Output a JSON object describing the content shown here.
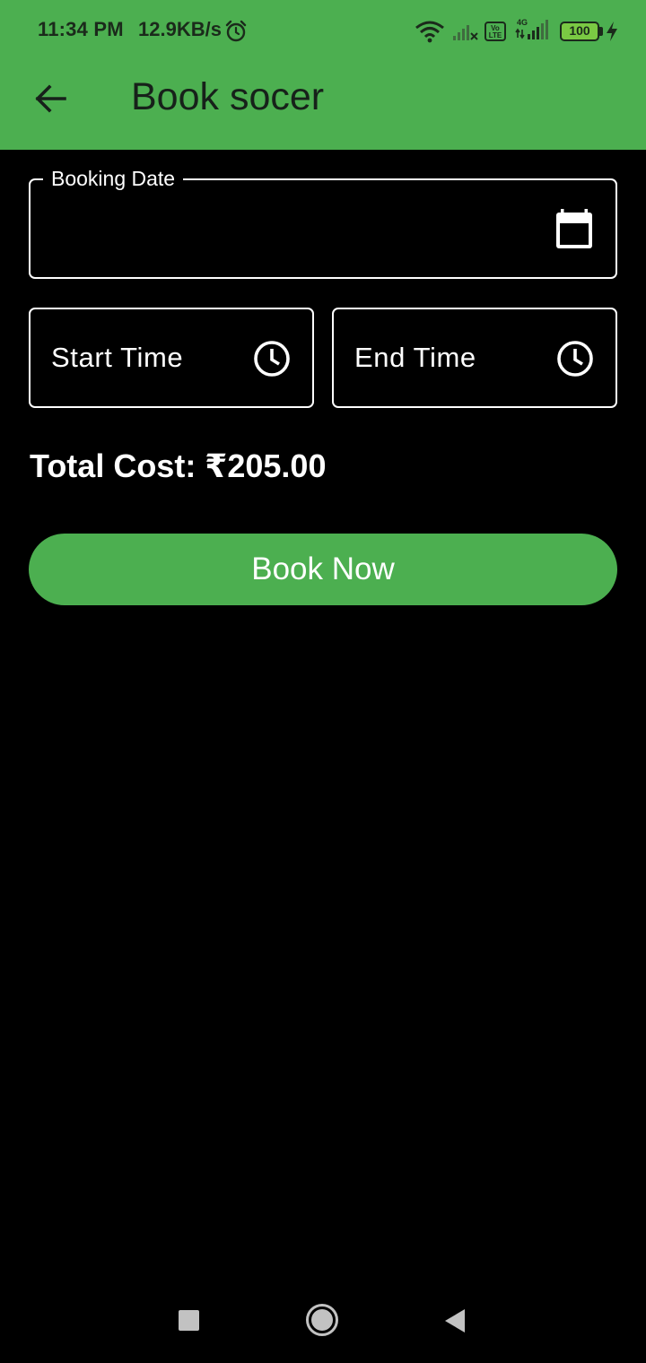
{
  "status_bar": {
    "time": "11:34 PM",
    "speed": "12.9KB/s",
    "volte": "Vo LTE",
    "network": "4G",
    "battery": "100",
    "icons": [
      "alarm-icon",
      "wifi-icon",
      "signal-icon",
      "volte-icon",
      "signal-4g-icon",
      "battery-icon",
      "charging-icon"
    ]
  },
  "app_bar": {
    "title": "Book socer",
    "back_icon": "arrow-left-icon",
    "color": "#4CAF50"
  },
  "form": {
    "booking_date": {
      "label": "Booking Date",
      "value": "",
      "icon": "calendar-icon"
    },
    "start_time": {
      "label": "Start Time",
      "icon": "clock-icon"
    },
    "end_time": {
      "label": "End Time",
      "icon": "clock-icon"
    }
  },
  "total_cost": "Total Cost: ₹205.00",
  "book_button": {
    "label": "Book Now",
    "color": "#4CAF50"
  },
  "nav_bar": {
    "icons": [
      "recents-icon",
      "home-icon",
      "back-icon"
    ]
  }
}
